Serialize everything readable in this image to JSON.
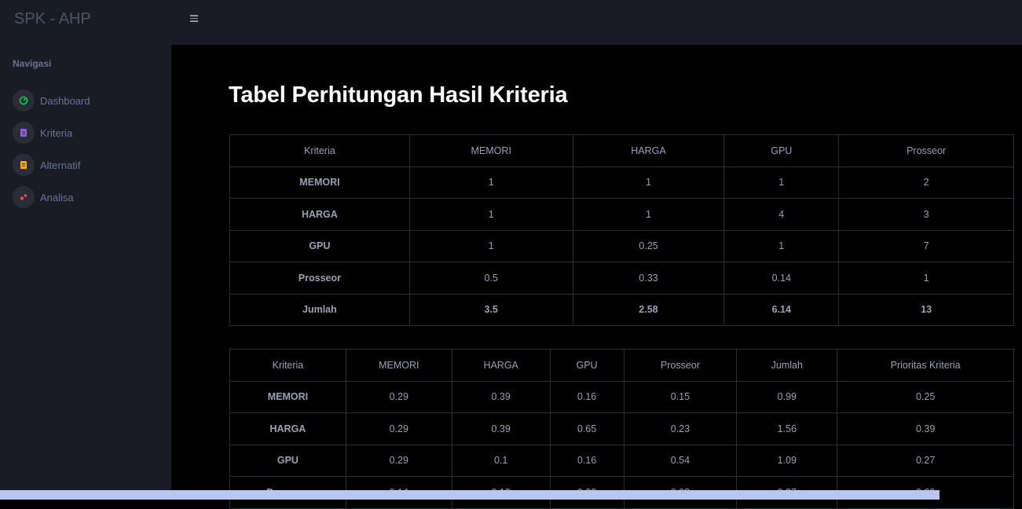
{
  "app": {
    "brand": "SPK - AHP"
  },
  "sidebar": {
    "title": "Navigasi",
    "items": [
      {
        "label": "Dashboard",
        "icon": "speedometer-icon",
        "color": "#00d25b"
      },
      {
        "label": "Kriteria",
        "icon": "clipboard-icon",
        "color": "#8f5fe8"
      },
      {
        "label": "Alternatif",
        "icon": "document-icon",
        "color": "#ffab00"
      },
      {
        "label": "Analisa",
        "icon": "chart-icon",
        "color": "#fc424a"
      }
    ]
  },
  "main": {
    "title": "Tabel Perhitungan Hasil Kriteria",
    "table1": {
      "headers": [
        "Kriteria",
        "MEMORI",
        "HARGA",
        "GPU",
        "Prosseor"
      ],
      "rows": [
        [
          "MEMORI",
          "1",
          "1",
          "1",
          "2"
        ],
        [
          "HARGA",
          "1",
          "1",
          "4",
          "3"
        ],
        [
          "GPU",
          "1",
          "0.25",
          "1",
          "7"
        ],
        [
          "Prosseor",
          "0.5",
          "0.33",
          "0.14",
          "1"
        ]
      ],
      "sum": [
        "Jumlah",
        "3.5",
        "2.58",
        "6.14",
        "13"
      ]
    },
    "table2": {
      "headers": [
        "Kriteria",
        "MEMORI",
        "HARGA",
        "GPU",
        "Prosseor",
        "Jumlah",
        "Prioritas Kriteria"
      ],
      "rows": [
        [
          "MEMORI",
          "0.29",
          "0.39",
          "0.16",
          "0.15",
          "0.99",
          "0.25"
        ],
        [
          "HARGA",
          "0.29",
          "0.39",
          "0.65",
          "0.23",
          "1.56",
          "0.39"
        ],
        [
          "GPU",
          "0.29",
          "0.1",
          "0.16",
          "0.54",
          "1.09",
          "0.27"
        ],
        [
          "Prosseor",
          "0.14",
          "0.13",
          "0.02",
          "0.08",
          "0.37",
          "0.09"
        ]
      ]
    }
  }
}
